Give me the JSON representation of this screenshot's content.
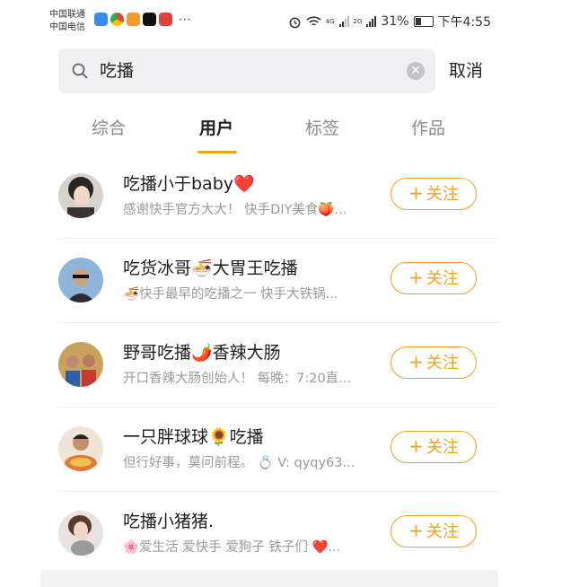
{
  "status_bar": {
    "carrier_1": "中国联通",
    "carrier_2": "中国电信",
    "more": "···",
    "sig_1": "4G",
    "sig_2": "2G",
    "battery": "31%",
    "time": "下午4:55"
  },
  "search": {
    "query": "吃播",
    "cancel_label": "取消"
  },
  "tabs": [
    {
      "label": "综合"
    },
    {
      "label": "用户"
    },
    {
      "label": "标签"
    },
    {
      "label": "作品"
    }
  ],
  "active_tab": "用户",
  "users": [
    {
      "name": "吃播小于baby❤️",
      "desc": "感谢快手官方大大！ 快手DIY美食🍑...",
      "follow_label": "关注"
    },
    {
      "name": "吃货冰哥🍜大胃王吃播",
      "desc": "🍜快手最早的吃播之一 快手大铁锅...",
      "follow_label": "关注"
    },
    {
      "name": "野哥吃播🌶️香辣大肠",
      "desc": "开口香辣大肠创始人！ 每晚：7:20直...",
      "follow_label": "关注"
    },
    {
      "name": "一只胖球球🌻吃播",
      "desc": "但行好事，莫问前程。 💍 V: qyqy63...",
      "follow_label": "关注"
    },
    {
      "name": "吃播小猪猪.",
      "desc": "🌸爱生活 爱快手 爱狗子 铁子们 ❤️...",
      "follow_label": "关注"
    }
  ],
  "colors": {
    "accent": "#f0a21c",
    "muted_text": "#999999"
  }
}
